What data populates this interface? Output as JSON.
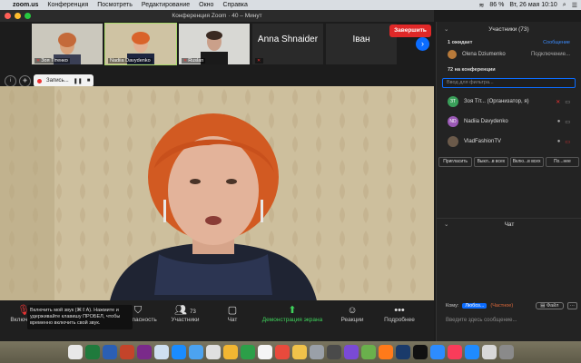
{
  "menubar": {
    "app": "zoom.us",
    "items": [
      "Конференция",
      "Посмотреть",
      "Редактирование",
      "Окно",
      "Справка"
    ],
    "battery": "86 %",
    "datetime": "Вт, 26 мая  10:10"
  },
  "window": {
    "title": "Конференция Zoom · 40 – Минут"
  },
  "strip": [
    {
      "name": "Зоя Тітенко"
    },
    {
      "name": "Nadiia Davydenko",
      "active": true
    },
    {
      "name": "Ruslan"
    },
    {
      "name": "Anna Shnaider"
    },
    {
      "name": "Іван"
    }
  ],
  "recording": {
    "label": "Запись..."
  },
  "toolbar": {
    "mute": "Включить",
    "security": "Безопасность",
    "participants": "Участники",
    "participants_count": "73",
    "chat": "Чат",
    "share": "Демонстрация экрана",
    "reactions": "Реакции",
    "more": "Подробнее",
    "end": "Завершить"
  },
  "tooltip": "Включить мой звук (⌘⇧A). Нажмите и удерживайте клавишу ПРОБЕЛ, чтобы временно включить свой звук.",
  "panel": {
    "title": "Участники (73)",
    "waiting_header": "1 ожидает",
    "waiting_action": "Сообщение",
    "waiting_name": "Olena Dziumenko",
    "waiting_status": "Подключение...",
    "in_meeting": "72 на конференции",
    "filter_placeholder": "Ввод для фильтра...",
    "participants": [
      {
        "initials": "ЗТ",
        "name": "Зоя Тіт...  (Организатор, я)",
        "color": "#3aa05a"
      },
      {
        "initials": "ND",
        "name": "Nadiia Davydenko",
        "color": "#9b59b6"
      },
      {
        "initials": "",
        "name": "VladFashionTV",
        "color": "#6b5a4a"
      }
    ],
    "buttons": [
      "Пригласить",
      "Выкл...в всех",
      "Вклю...в всех",
      "По...нее"
    ]
  },
  "chat": {
    "title": "Чат",
    "to_label": "Кому:",
    "to_value": "Любоз...",
    "private": "(Частное)",
    "file": "Файл",
    "input_placeholder": "Введите здесь сообщение..."
  },
  "colors": {
    "accent": "#0b6cff",
    "end": "#e02828",
    "share": "#3fd15b"
  }
}
